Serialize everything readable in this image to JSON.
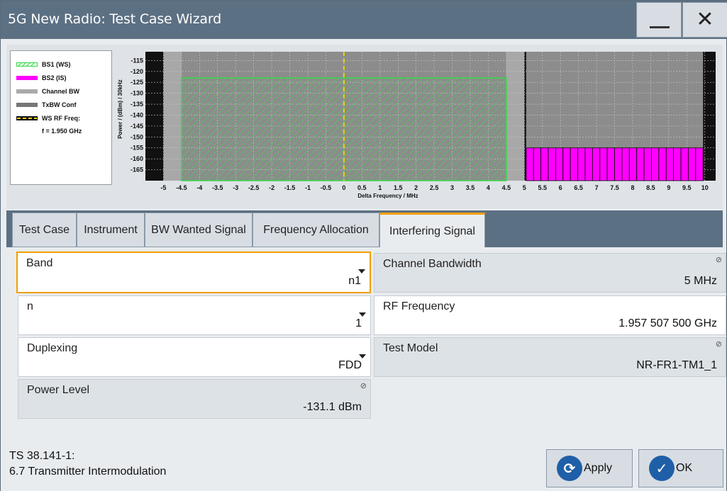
{
  "window": {
    "title": "5G New Radio: Test Case Wizard",
    "minimize_glyph": "—",
    "close_glyph": "✕"
  },
  "legend": {
    "items": [
      {
        "label": "BS1 (WS)",
        "swatch": "hatched-green",
        "color": "#39d84a"
      },
      {
        "label": "BS2 (IS)",
        "swatch": "solid",
        "color": "#ff00ff"
      },
      {
        "label": "Channel BW",
        "swatch": "solid",
        "color": "#aaaaaa"
      },
      {
        "label": "TxBW Conf",
        "swatch": "solid",
        "color": "#777777"
      },
      {
        "label": "WS RF Freq:",
        "swatch": "dashed",
        "color": "#f0d000"
      }
    ],
    "freq_note": "f = 1.950 GHz"
  },
  "chart_data": {
    "type": "bar",
    "xlabel": "Delta Frequency / MHz",
    "ylabel": "Power / (dBm) / 30kHz",
    "xlim": [
      -5.5,
      10.3
    ],
    "ylim": [
      -170,
      -111
    ],
    "x_ticks": [
      "-5",
      "-4.5",
      "-4",
      "-3.5",
      "-3",
      "-2.5",
      "-2",
      "-1.5",
      "-1",
      "-0.5",
      "0",
      "0.5",
      "1",
      "1.5",
      "2",
      "2.5",
      "3",
      "3.5",
      "4",
      "4.5",
      "5",
      "5.5",
      "6",
      "6.5",
      "7",
      "7.5",
      "8",
      "8.5",
      "9",
      "9.5",
      "10"
    ],
    "y_ticks": [
      "-115",
      "-120",
      "-125",
      "-130",
      "-135",
      "-140",
      "-145",
      "-150",
      "-155",
      "-160",
      "-165"
    ],
    "series": [
      {
        "name": "BS1 (WS)",
        "x_start": -4.5,
        "x_end": 4.5,
        "level": -123,
        "color": "#39d84a",
        "style": "hatched"
      },
      {
        "name": "BS2 (IS)",
        "x_start": 5.05,
        "x_end": 9.95,
        "level": -155,
        "color": "#ff00ff",
        "style": "bars",
        "bars": 24
      }
    ],
    "channel_bw": [
      -5.0,
      5.0
    ],
    "txbw": [
      -4.5,
      4.5
    ],
    "ws_rf_freq": 0
  },
  "tabs": [
    {
      "label": "Test Case",
      "active": false
    },
    {
      "label": "Instrument",
      "active": false
    },
    {
      "label": "BW Wanted Signal",
      "active": false
    },
    {
      "label": "Frequency Allocation",
      "active": false
    },
    {
      "label": "Interfering Signal",
      "active": true
    }
  ],
  "fields": {
    "band": {
      "label": "Band",
      "value": "n1"
    },
    "n": {
      "label": "n",
      "value": "1"
    },
    "duplexing": {
      "label": "Duplexing",
      "value": "FDD"
    },
    "power_level": {
      "label": "Power Level",
      "value": "-131.1 dBm"
    },
    "channel_bandwidth": {
      "label": "Channel Bandwidth",
      "value": "5 MHz"
    },
    "rf_frequency": {
      "label": "RF Frequency",
      "value": "1.957 507 500 GHz"
    },
    "test_model": {
      "label": "Test Model",
      "value": "NR-FR1-TM1_1"
    }
  },
  "footer": {
    "spec_line1": "TS 38.141-1:",
    "spec_line2": "6.7 Transmitter Intermodulation",
    "apply_label": "Apply",
    "ok_label": "OK",
    "ok_glyph": "✓",
    "apply_glyph": "⟳",
    "lock_glyph": "⊘"
  }
}
